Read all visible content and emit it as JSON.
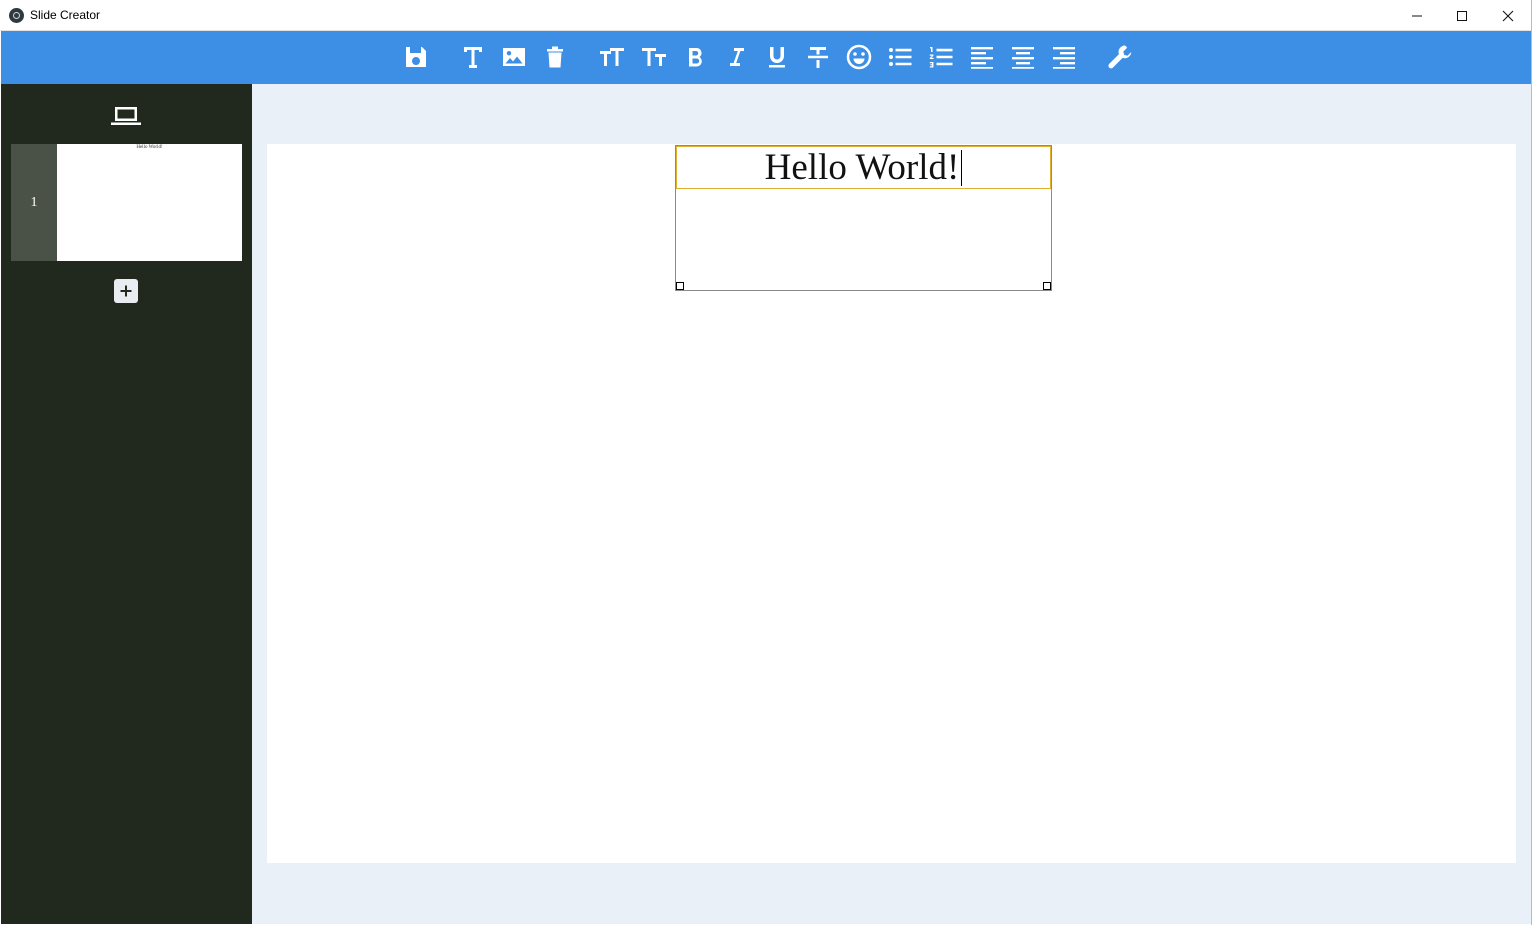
{
  "window": {
    "title": "Slide Creator",
    "controls": [
      "minimize-icon",
      "maximize-icon",
      "close-icon"
    ]
  },
  "toolbar": {
    "colors": {
      "background": "#3d8fe6",
      "icon": "#ffffff"
    },
    "buttons": [
      {
        "name": "save",
        "icon": "save-icon"
      },
      {
        "name": "add-text",
        "icon": "text-icon"
      },
      {
        "name": "add-image",
        "icon": "image-icon"
      },
      {
        "name": "delete",
        "icon": "trash-icon"
      },
      {
        "name": "increase-font-size",
        "icon": "font-size-increase-icon"
      },
      {
        "name": "decrease-font-size",
        "icon": "font-size-decrease-icon"
      },
      {
        "name": "bold",
        "icon": "bold-icon"
      },
      {
        "name": "italic",
        "icon": "italic-icon"
      },
      {
        "name": "underline",
        "icon": "underline-icon"
      },
      {
        "name": "strikethrough",
        "icon": "strikethrough-icon"
      },
      {
        "name": "emoji",
        "icon": "emoji-icon"
      },
      {
        "name": "bulleted-list",
        "icon": "bulleted-list-icon"
      },
      {
        "name": "numbered-list",
        "icon": "numbered-list-icon"
      },
      {
        "name": "align-left",
        "icon": "align-left-icon"
      },
      {
        "name": "align-center",
        "icon": "align-center-icon"
      },
      {
        "name": "align-right",
        "icon": "align-right-icon"
      },
      {
        "name": "settings",
        "icon": "wrench-icon"
      }
    ]
  },
  "sidebar": {
    "colors": {
      "background": "#21291f",
      "thumb_strip": "#4a5147"
    },
    "present_icon": "laptop-icon",
    "slides": [
      {
        "number": "1",
        "preview_text": "Hello World!"
      }
    ],
    "add_slide_icon": "plus-icon"
  },
  "editor": {
    "colors": {
      "workspace": "#e9f0f8",
      "selection_border": "#e0b030"
    },
    "text_box": {
      "text": "Hello World!"
    }
  }
}
